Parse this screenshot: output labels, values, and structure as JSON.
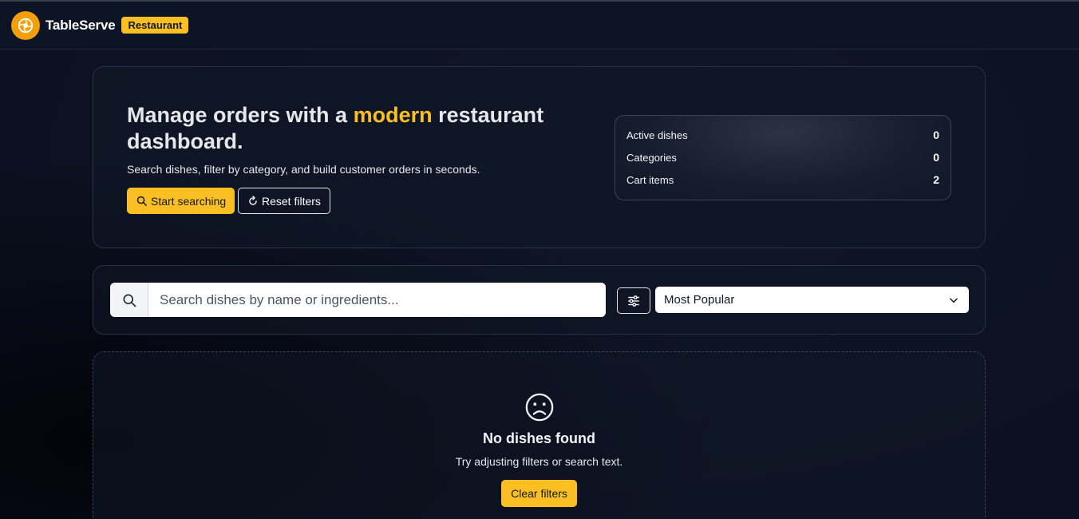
{
  "colors": {
    "accent": "#fbbf24",
    "background": "#0b1120",
    "logo": "#f59e0b"
  },
  "navbar": {
    "brand": "TableServe",
    "badge": "Restaurant",
    "logo_icon": "camera-lens-icon"
  },
  "hero": {
    "title_prefix": "Manage orders with a ",
    "title_highlight": "modern",
    "title_suffix": " restaurant dashboard.",
    "subtitle": "Search dishes, filter by category, and build customer orders in seconds.",
    "primary_button": {
      "label": "Start searching",
      "icon": "search-icon"
    },
    "secondary_button": {
      "label": "Reset filters",
      "icon": "refresh-icon"
    }
  },
  "stats": [
    {
      "label": "Active dishes",
      "value": "0"
    },
    {
      "label": "Categories",
      "value": "0"
    },
    {
      "label": "Cart items",
      "value": "2"
    }
  ],
  "search": {
    "placeholder": "Search dishes by name or ingredients...",
    "value": "",
    "filter_icon": "sliders-icon",
    "sort_selected": "Most Popular"
  },
  "empty_state": {
    "icon": "sad-face-icon",
    "title": "No dishes found",
    "subtitle": "Try adjusting filters or search text.",
    "button_label": "Clear filters"
  }
}
